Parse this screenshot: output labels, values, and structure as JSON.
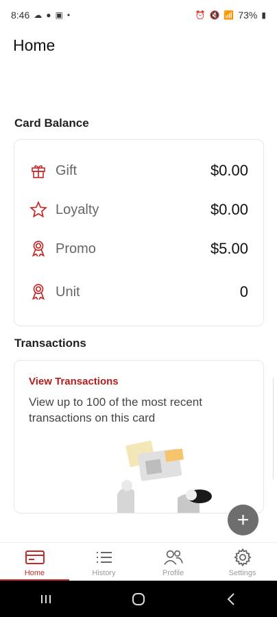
{
  "status_bar": {
    "time": "8:46",
    "battery": "73%",
    "left_icons": [
      "cloud-icon",
      "app-icon",
      "hd-icon",
      "dot-icon"
    ],
    "right_icons": [
      "alarm-icon",
      "mute-icon",
      "wifi-icon",
      "signal-icon",
      "battery-icon"
    ]
  },
  "header": {
    "title": "Home"
  },
  "card_balance": {
    "title": "Card Balance",
    "rows": [
      {
        "label": "Gift",
        "value": "$0.00",
        "icon": "gift-icon"
      },
      {
        "label": "Loyalty",
        "value": "$0.00",
        "icon": "star-icon"
      },
      {
        "label": "Promo",
        "value": "$5.00",
        "icon": "award-icon"
      },
      {
        "label": "Unit",
        "value": "0",
        "icon": "award-icon"
      }
    ]
  },
  "transactions": {
    "title": "Transactions",
    "link": "View Transactions",
    "description": "View up to 100 of the most recent transactions on this card"
  },
  "fab": {
    "label": "+"
  },
  "bottom_nav": {
    "items": [
      {
        "label": "Home",
        "icon": "card-icon",
        "active": true
      },
      {
        "label": "History",
        "icon": "list-icon",
        "active": false
      },
      {
        "label": "Profile",
        "icon": "users-icon",
        "active": false
      },
      {
        "label": "Settings",
        "icon": "gear-icon",
        "active": false
      }
    ]
  },
  "colors": {
    "accent": "#c62828",
    "fab": "#6e6e6e"
  }
}
